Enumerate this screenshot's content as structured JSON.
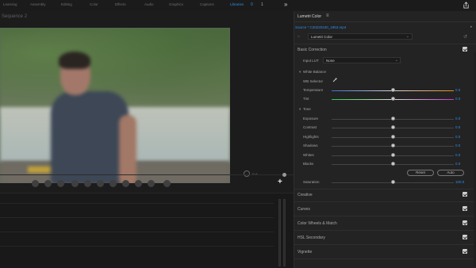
{
  "topbar": {
    "tabs": [
      {
        "label": "Learning",
        "active": false
      },
      {
        "label": "Assembly",
        "active": false
      },
      {
        "label": "Editing",
        "active": false
      },
      {
        "label": "Color",
        "active": false
      },
      {
        "label": "Effects",
        "active": false
      },
      {
        "label": "Audio",
        "active": false
      },
      {
        "label": "Graphics",
        "active": false
      },
      {
        "label": "Captions",
        "active": false
      },
      {
        "label": "Libraries",
        "active": true
      }
    ],
    "active_count": "0",
    "more_label": "1",
    "overflow_glyph": "»",
    "share_icon": "share-icon"
  },
  "monitor": {
    "sequence_label": "Sequence 2",
    "zoom_label": "Full"
  },
  "lumetri": {
    "title": "Lumetri Color",
    "menu_glyph": "≡",
    "source": "Source * C20220430_1953.mp4",
    "source_arrow": "▸",
    "fx_icon": "fx",
    "effect_select": "Lumetri Color",
    "reset_glyph": "↺",
    "basic_correction": {
      "title": "Basic Correction",
      "checked": true,
      "input_lut_label": "Input LUT",
      "input_lut_value": "None",
      "white_balance": {
        "title": "White Balance",
        "selector_label": "WB Selector",
        "temperature": {
          "label": "Temperature",
          "value": "0.0"
        },
        "tint": {
          "label": "Tint",
          "value": "0.0"
        }
      },
      "tone": {
        "title": "Tone",
        "rows": [
          {
            "label": "Exposure",
            "value": "0.0"
          },
          {
            "label": "Contrast",
            "value": "0.0"
          },
          {
            "label": "Highlights",
            "value": "0.0"
          },
          {
            "label": "Shadows",
            "value": "0.0"
          },
          {
            "label": "Whites",
            "value": "0.0"
          },
          {
            "label": "Blacks",
            "value": "0.0"
          }
        ],
        "reset_label": "Reset",
        "auto_label": "Auto"
      },
      "saturation": {
        "label": "Saturation",
        "value": "100.0"
      }
    },
    "sections": [
      {
        "title": "Creative",
        "checked": true
      },
      {
        "title": "Curves",
        "checked": true
      },
      {
        "title": "Color Wheels & Match",
        "checked": true
      },
      {
        "title": "HSL Secondary",
        "checked": true
      },
      {
        "title": "Vignette",
        "checked": true
      }
    ]
  },
  "colors": {
    "accent": "#2f8ee8",
    "temperature_gradient": [
      "#3b6fd6",
      "#d8d8d8",
      "#e38a23"
    ],
    "tint_gradient": [
      "#2fc84a",
      "#d8d8d8",
      "#c23cc9"
    ]
  }
}
